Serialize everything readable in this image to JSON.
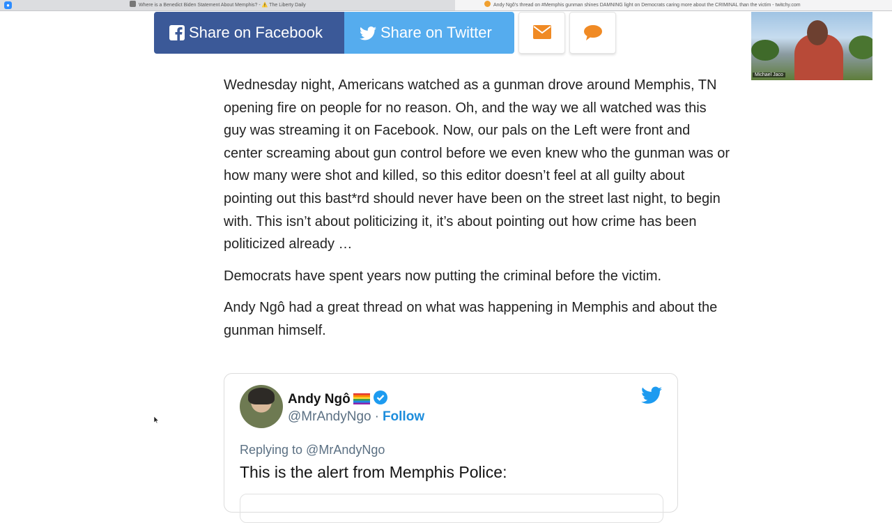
{
  "browser": {
    "tabs": [
      {
        "title": "Where is a Benedict Biden Statement About Memphis? - ⚠️ The Liberty Daily"
      },
      {
        "title": "Andy Ngô's thread on #Memphis gunman shines DAMNING light on Democrats caring more about the CRIMINAL than the victim - twitchy.com"
      }
    ]
  },
  "share": {
    "facebook_label": "Share on Facebook",
    "twitter_label": "Share on Twitter",
    "colors": {
      "facebook": "#3b5998",
      "twitter": "#55acee",
      "accent": "#f08a24"
    }
  },
  "video": {
    "participant_name": "Michael Jaco"
  },
  "article": {
    "p1": "Wednesday night, Americans watched as a gunman drove around Memphis, TN opening fire on people for no reason. Oh, and the way we all watched was this guy was streaming it on Facebook. Now, our pals on the Left were front and center screaming about gun control before we even knew who the gunman was or how many were shot and killed, so this editor doesn’t feel at all guilty about pointing out this bast*rd should never have been on the street last night, to begin with. This isn’t about politicizing it, it’s about pointing out how crime has been politicized already …",
    "p2": "Democrats have spent years now putting the criminal before the victim.",
    "p3": "Andy Ngô had a great thread on what was happening in Memphis and about the gunman himself."
  },
  "tweet": {
    "name": "Andy Ngô",
    "handle": "@MrAndyNgo",
    "separator": "·",
    "follow_label": "Follow",
    "replying_to": "Replying to @MrAndyNgo",
    "text": "This is the alert from Memphis Police:",
    "colors": {
      "twitter_blue": "#1d9bf0"
    }
  }
}
